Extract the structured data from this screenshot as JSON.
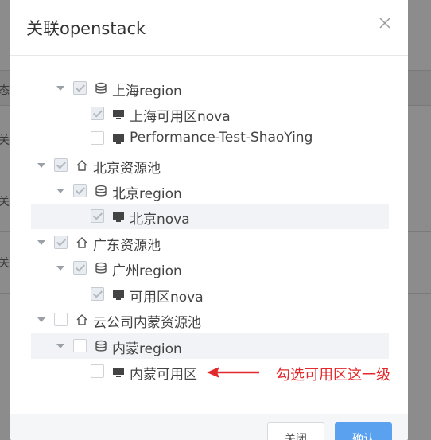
{
  "modal": {
    "title": "关联openstack",
    "close_icon": "close-icon"
  },
  "background": {
    "row_labels": [
      "态",
      "关",
      "关",
      "关"
    ]
  },
  "tree": {
    "nodes": [
      {
        "label": "上海region",
        "icon": "database-icon",
        "checked": true
      },
      {
        "label": "上海可用区nova",
        "icon": "monitor-icon",
        "checked": true
      },
      {
        "label": "Performance-Test-ShaoYing",
        "icon": "monitor-icon",
        "checked": false
      },
      {
        "label": "北京资源池",
        "icon": "home-icon",
        "checked": true
      },
      {
        "label": "北京region",
        "icon": "database-icon",
        "checked": true
      },
      {
        "label": "北京nova",
        "icon": "monitor-icon",
        "checked": true
      },
      {
        "label": "广东资源池",
        "icon": "home-icon",
        "checked": true
      },
      {
        "label": "广州region",
        "icon": "database-icon",
        "checked": true
      },
      {
        "label": "可用区nova",
        "icon": "monitor-icon",
        "checked": true
      },
      {
        "label": "云公司内蒙资源池",
        "icon": "home-icon",
        "checked": false
      },
      {
        "label": "内蒙region",
        "icon": "database-icon",
        "checked": false
      },
      {
        "label": "内蒙可用区",
        "icon": "monitor-icon",
        "checked": false
      }
    ]
  },
  "annotation": {
    "text": "勾选可用区这一级",
    "color": "#e2292c"
  },
  "footer": {
    "close_label": "关闭",
    "confirm_label": "确认"
  },
  "colors": {
    "primary": "#5aa2ef",
    "highlight_row": "#f1f3f7"
  }
}
